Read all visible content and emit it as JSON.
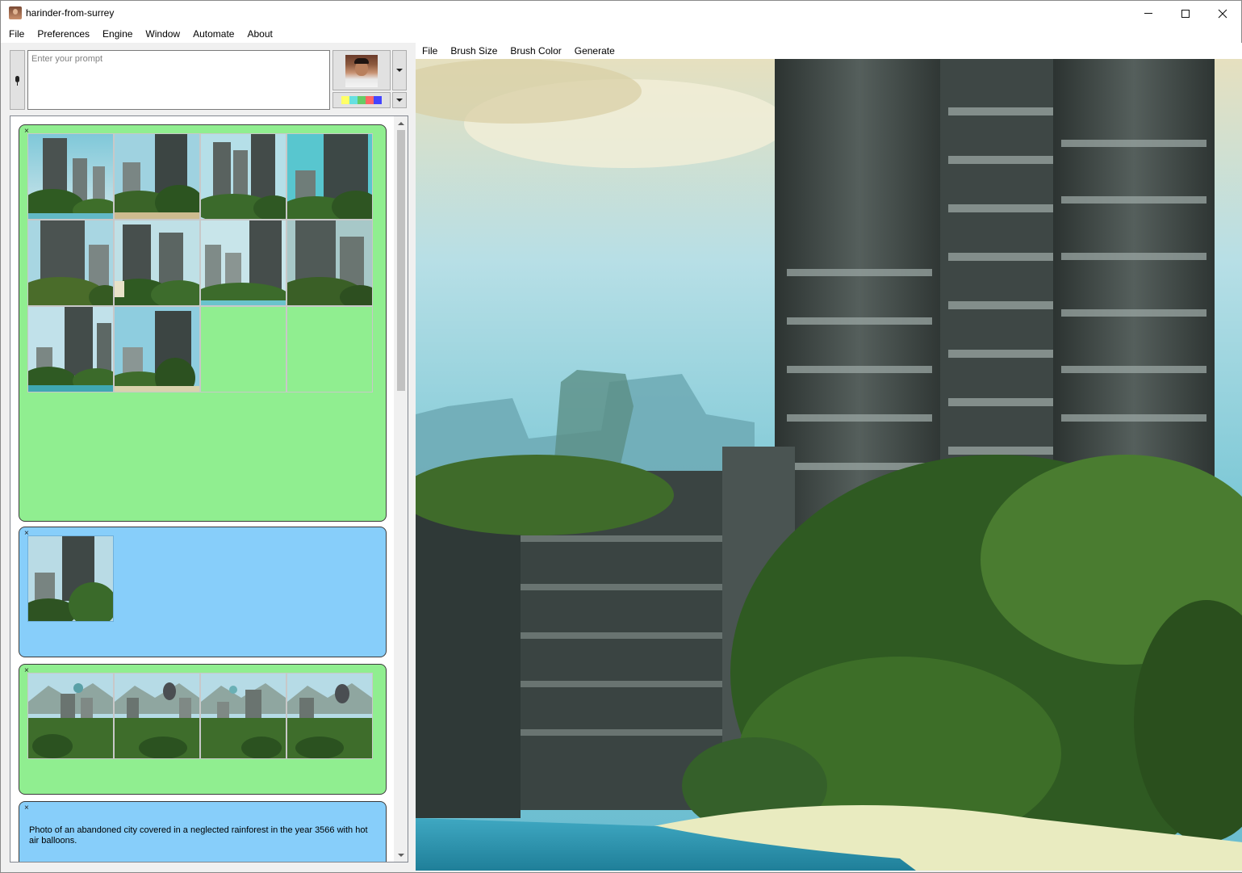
{
  "window": {
    "title": "harinder-from-surrey",
    "controls": {
      "minimize": "minimize",
      "maximize": "maximize",
      "close": "close"
    }
  },
  "main_menu": [
    "File",
    "Preferences",
    "Engine",
    "Window",
    "Automate",
    "About"
  ],
  "prompt": {
    "placeholder": "Enter your prompt",
    "value": ""
  },
  "palette": [
    "#ffff66",
    "#66e0e0",
    "#66cc66",
    "#ff6666",
    "#4444ff"
  ],
  "canvas_menu": [
    "File",
    "Brush Size",
    "Brush Color",
    "Generate"
  ],
  "cards": [
    {
      "color": "#90ee90",
      "close_label": "×",
      "image_count": 10,
      "images": [
        {
          "alt": "overgrown skyscrapers"
        },
        {
          "alt": "overgrown skyscrapers"
        },
        {
          "alt": "overgrown skyscrapers"
        },
        {
          "alt": "overgrown skyscrapers"
        },
        {
          "alt": "overgrown skyscrapers"
        },
        {
          "alt": "overgrown skyscrapers"
        },
        {
          "alt": "overgrown skyscrapers"
        },
        {
          "alt": "overgrown skyscrapers"
        },
        {
          "alt": "overgrown skyscrapers"
        },
        {
          "alt": "overgrown skyscrapers"
        }
      ]
    },
    {
      "color": "#87cefa",
      "close_label": "×",
      "image_count": 1,
      "images": [
        {
          "alt": "overgrown skyscraper"
        }
      ]
    },
    {
      "color": "#90ee90",
      "close_label": "×",
      "image_count": 4,
      "images": [
        {
          "alt": "city with hot air balloons"
        },
        {
          "alt": "city with hot air balloons"
        },
        {
          "alt": "city with hot air balloons"
        },
        {
          "alt": "city with hot air balloons"
        }
      ]
    },
    {
      "color": "#87cefa",
      "close_label": "×",
      "text": "Photo of an abandoned city covered in a neglected rainforest in the year 3566 with hot air balloons."
    }
  ]
}
